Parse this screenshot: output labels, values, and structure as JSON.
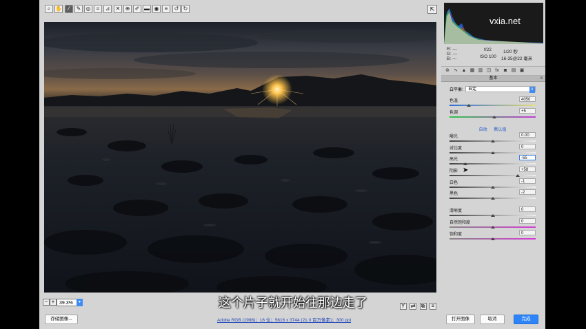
{
  "toolbar": {
    "tools": [
      {
        "name": "zoom-tool",
        "icon": "zoom-icon",
        "glyph": "⌕"
      },
      {
        "name": "hand-tool",
        "icon": "hand-icon",
        "glyph": "✋"
      },
      {
        "name": "white-balance-tool",
        "icon": "eyedropper-icon",
        "glyph": "⁄"
      },
      {
        "name": "color-sampler-tool",
        "icon": "sampler-icon",
        "glyph": "✎"
      },
      {
        "name": "targeted-adjustment-tool",
        "icon": "target-icon",
        "glyph": "◎"
      },
      {
        "name": "crop-tool",
        "icon": "crop-icon",
        "glyph": "⌗"
      },
      {
        "name": "straighten-tool",
        "icon": "straighten-icon",
        "glyph": "⊿"
      },
      {
        "name": "spot-removal-tool",
        "icon": "spot-icon",
        "glyph": "✕"
      },
      {
        "name": "red-eye-tool",
        "icon": "redeye-icon",
        "glyph": "⊕"
      },
      {
        "name": "adjustment-brush-tool",
        "icon": "brush-icon",
        "glyph": "✐"
      },
      {
        "name": "graduated-filter-tool",
        "icon": "gradient-icon",
        "glyph": "▬"
      },
      {
        "name": "radial-filter-tool",
        "icon": "radial-icon",
        "glyph": "◉"
      },
      {
        "name": "preferences-tool",
        "icon": "list-icon",
        "glyph": "≡"
      },
      {
        "name": "rotate-left-tool",
        "icon": "rotate-left-icon",
        "glyph": "↺"
      },
      {
        "name": "rotate-right-tool",
        "icon": "rotate-right-icon",
        "glyph": "↻"
      }
    ],
    "open_icon_glyph": "⇱"
  },
  "preview": {
    "zoom_value": "39.3%"
  },
  "histogram": {
    "watermark": "vxia.net"
  },
  "info": {
    "r_label": "R:",
    "g_label": "G:",
    "b_label": "B:",
    "rgb_placeholder": "---",
    "aperture": "f/22",
    "shutter": "1/20 秒",
    "iso": "ISO 100",
    "lens": "16-35@22 毫米"
  },
  "panel": {
    "title": "基本",
    "wb_label": "白平衡:",
    "wb_value": "自定",
    "auto_label": "自动",
    "default_label": "默认值",
    "sliders": [
      {
        "id": "temperature",
        "label": "色温",
        "value": "4050",
        "pos": 0.22,
        "track": "temp"
      },
      {
        "id": "tint",
        "label": "色调",
        "value": "+5",
        "pos": 0.52,
        "track": "tint"
      },
      {
        "id": "exposure",
        "label": "曝光",
        "value": "0.00",
        "pos": 0.5,
        "track": "gray"
      },
      {
        "id": "contrast",
        "label": "对比度",
        "value": "0",
        "pos": 0.5,
        "track": "gray"
      },
      {
        "id": "highlights",
        "label": "高光",
        "value": "-65",
        "pos": 0.18,
        "track": "gray",
        "focused": true
      },
      {
        "id": "shadows",
        "label": "阴影",
        "value": "+58",
        "pos": 0.79,
        "track": "gray"
      },
      {
        "id": "whites",
        "label": "白色",
        "value": "-1",
        "pos": 0.5,
        "track": "gray"
      },
      {
        "id": "blacks",
        "label": "黑色",
        "value": "-2",
        "pos": 0.5,
        "track": "gray"
      },
      {
        "id": "clarity",
        "label": "清晰度",
        "value": "0",
        "pos": 0.5,
        "track": "gray"
      },
      {
        "id": "vibrance",
        "label": "自然饱和度",
        "value": "0",
        "pos": 0.5,
        "track": "vib"
      },
      {
        "id": "saturation",
        "label": "饱和度",
        "value": "0",
        "pos": 0.5,
        "track": "sat"
      }
    ]
  },
  "footer": {
    "save_label": "存储图像...",
    "workflow_link": "Adobe RGB (1998)；16 位；5616 x 3744 (21.0 百万像素)；300 ppi",
    "open_label": "打开图像",
    "cancel_label": "取消",
    "done_label": "完成"
  },
  "subtitle": "这个片子就开始往那边走了",
  "colors": {
    "accent": "#2f85f7",
    "panel_bg": "#d4d4d4"
  }
}
